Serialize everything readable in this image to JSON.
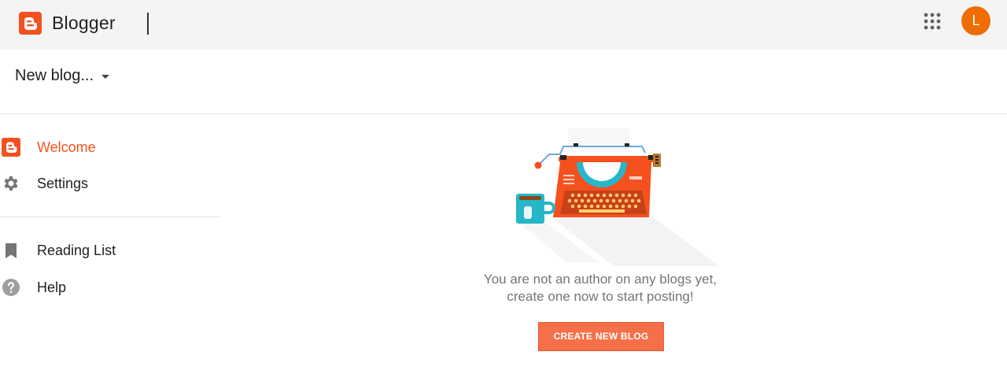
{
  "header": {
    "app_title": "Blogger",
    "account_initial": "L",
    "brand_color": "#f4511e",
    "avatar_color": "#ef6c00"
  },
  "blog_selector": {
    "label": "New blog..."
  },
  "sidebar": {
    "items": [
      {
        "label": "Welcome",
        "icon": "blogger-icon",
        "active": true
      },
      {
        "label": "Settings",
        "icon": "gear-icon",
        "active": false
      },
      {
        "label": "Reading List",
        "icon": "bookmark-icon",
        "active": false
      },
      {
        "label": "Help",
        "icon": "help-icon",
        "active": false
      }
    ]
  },
  "main": {
    "message_line1": "You are not an author on any blogs yet,",
    "message_line2": "create one now to start posting!",
    "create_button": "CREATE NEW BLOG",
    "illustration": "typewriter-illustration"
  }
}
